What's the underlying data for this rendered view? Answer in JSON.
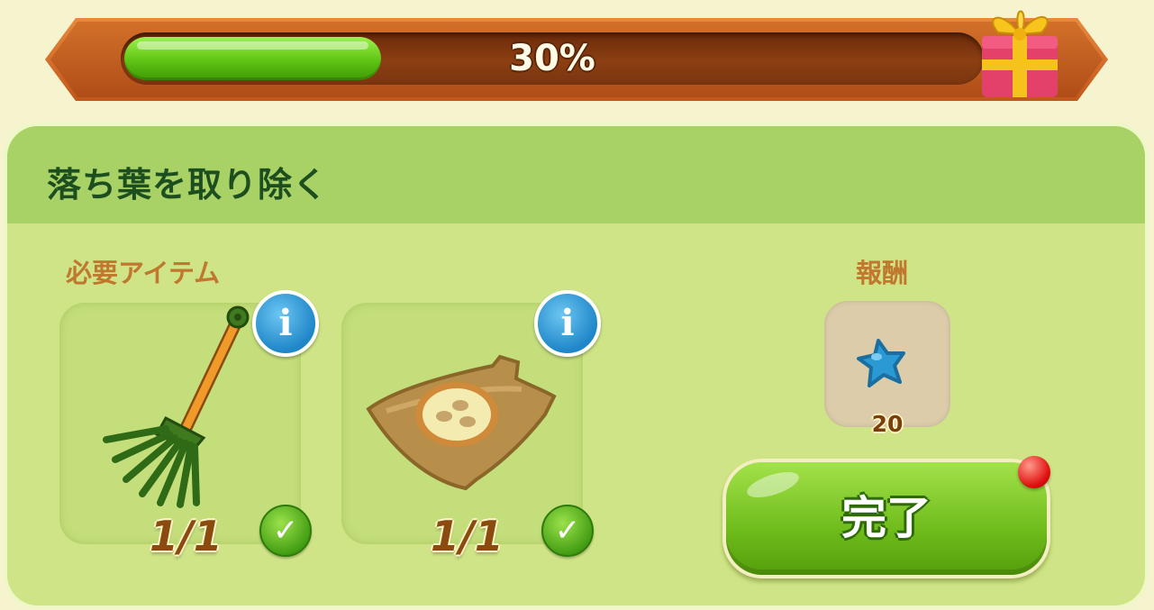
{
  "progress": {
    "percent_text": "30%",
    "fraction": 0.3
  },
  "task": {
    "title": "落ち葉を取り除く"
  },
  "required": {
    "label": "必要アイテム",
    "items": [
      {
        "icon": "rake-icon",
        "count": "1/1",
        "complete": true
      },
      {
        "icon": "seed-sack-icon",
        "count": "1/1",
        "complete": true
      }
    ]
  },
  "reward": {
    "label": "報酬",
    "icon": "blue-star-icon",
    "amount": "20"
  },
  "complete_button": {
    "label": "完了"
  },
  "colors": {
    "progress_fill": "#5ec414",
    "header_green": "#a8d266",
    "panel_green": "#cfe486",
    "title_text": "#1d4e1f",
    "section_label": "#c0772e",
    "button_green": "#6fbc1c"
  }
}
